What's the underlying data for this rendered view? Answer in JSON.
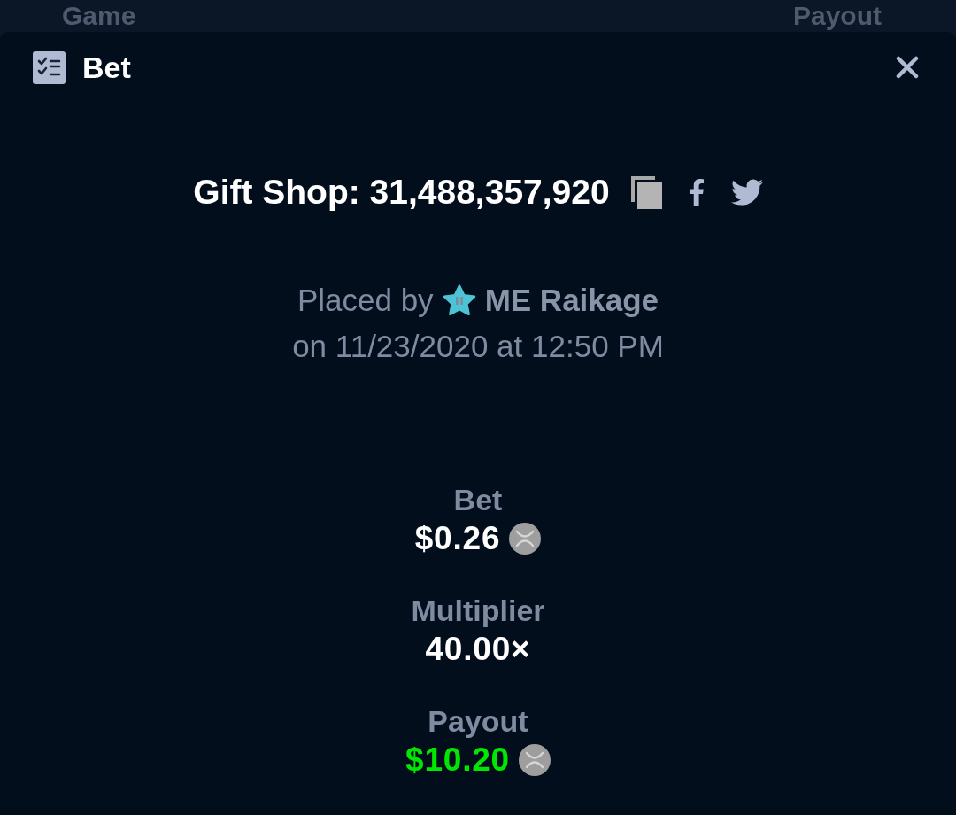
{
  "backdrop": {
    "column_headers": [
      "Game",
      "Payout"
    ]
  },
  "modal": {
    "title": "Bet"
  },
  "bet": {
    "heading": "Gift Shop: 31,488,357,920"
  },
  "placed": {
    "prefix": "Placed by",
    "user": "ME Raikage",
    "timestamp": "on 11/23/2020 at 12:50 PM"
  },
  "stats": [
    {
      "label": "Bet",
      "value": "$0.26",
      "kind": "currency",
      "color": "#ffffff"
    },
    {
      "label": "Multiplier",
      "value": "40.00×",
      "kind": "plain",
      "color": "#ffffff"
    },
    {
      "label": "Payout",
      "value": "$10.20",
      "kind": "currency",
      "color": "#00e701"
    }
  ]
}
